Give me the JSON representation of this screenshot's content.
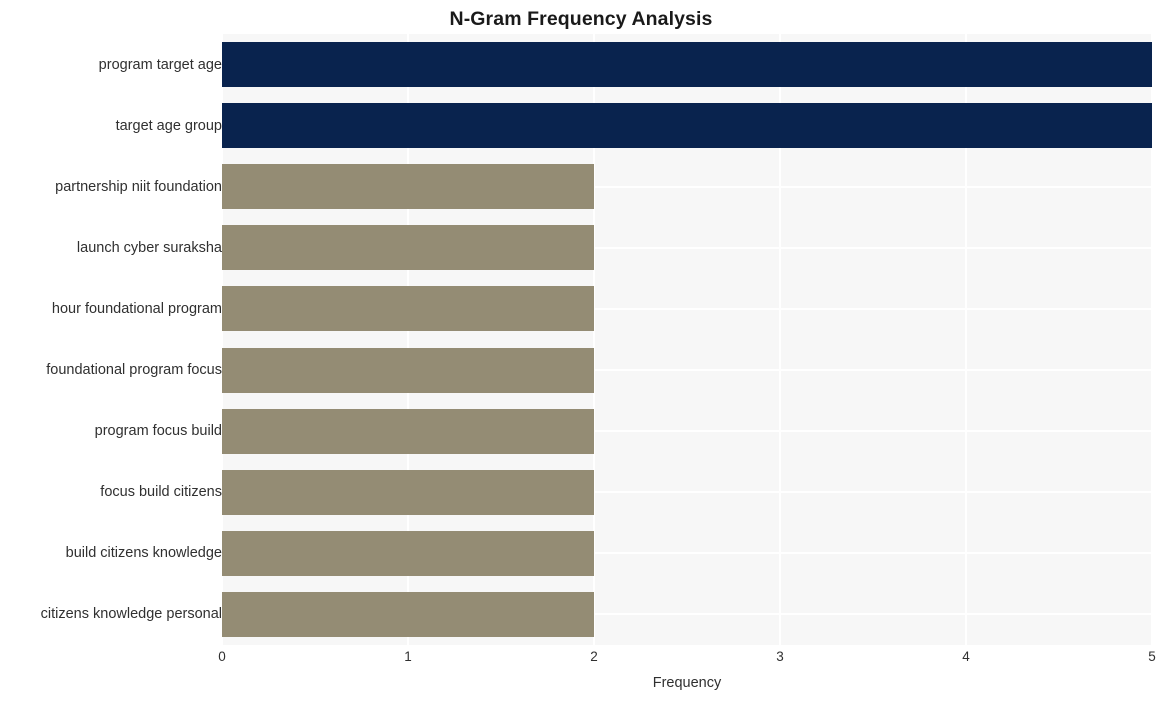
{
  "chart_data": {
    "type": "bar",
    "orientation": "horizontal",
    "title": "N-Gram Frequency Analysis",
    "xlabel": "Frequency",
    "ylabel": "",
    "categories": [
      "program target age",
      "target age group",
      "partnership niit foundation",
      "launch cyber suraksha",
      "hour foundational program",
      "foundational program focus",
      "program focus build",
      "focus build citizens",
      "build citizens knowledge",
      "citizens knowledge personal"
    ],
    "values": [
      5,
      5,
      2,
      2,
      2,
      2,
      2,
      2,
      2,
      2
    ],
    "bar_colors": [
      "#09234e",
      "#09234e",
      "#948c74",
      "#948c74",
      "#948c74",
      "#948c74",
      "#948c74",
      "#948c74",
      "#948c74",
      "#948c74"
    ],
    "xlim": [
      0,
      5
    ],
    "xticks": [
      0,
      1,
      2,
      3,
      4,
      5
    ],
    "xtick_labels": [
      "0",
      "1",
      "2",
      "3",
      "4",
      "5"
    ],
    "grid": true,
    "grid_color": "#ffffff",
    "plot_background": "#f7f7f7",
    "figure_background": "#ffffff",
    "legend": null,
    "highlight_color": "#09234e",
    "base_color": "#948c74"
  }
}
